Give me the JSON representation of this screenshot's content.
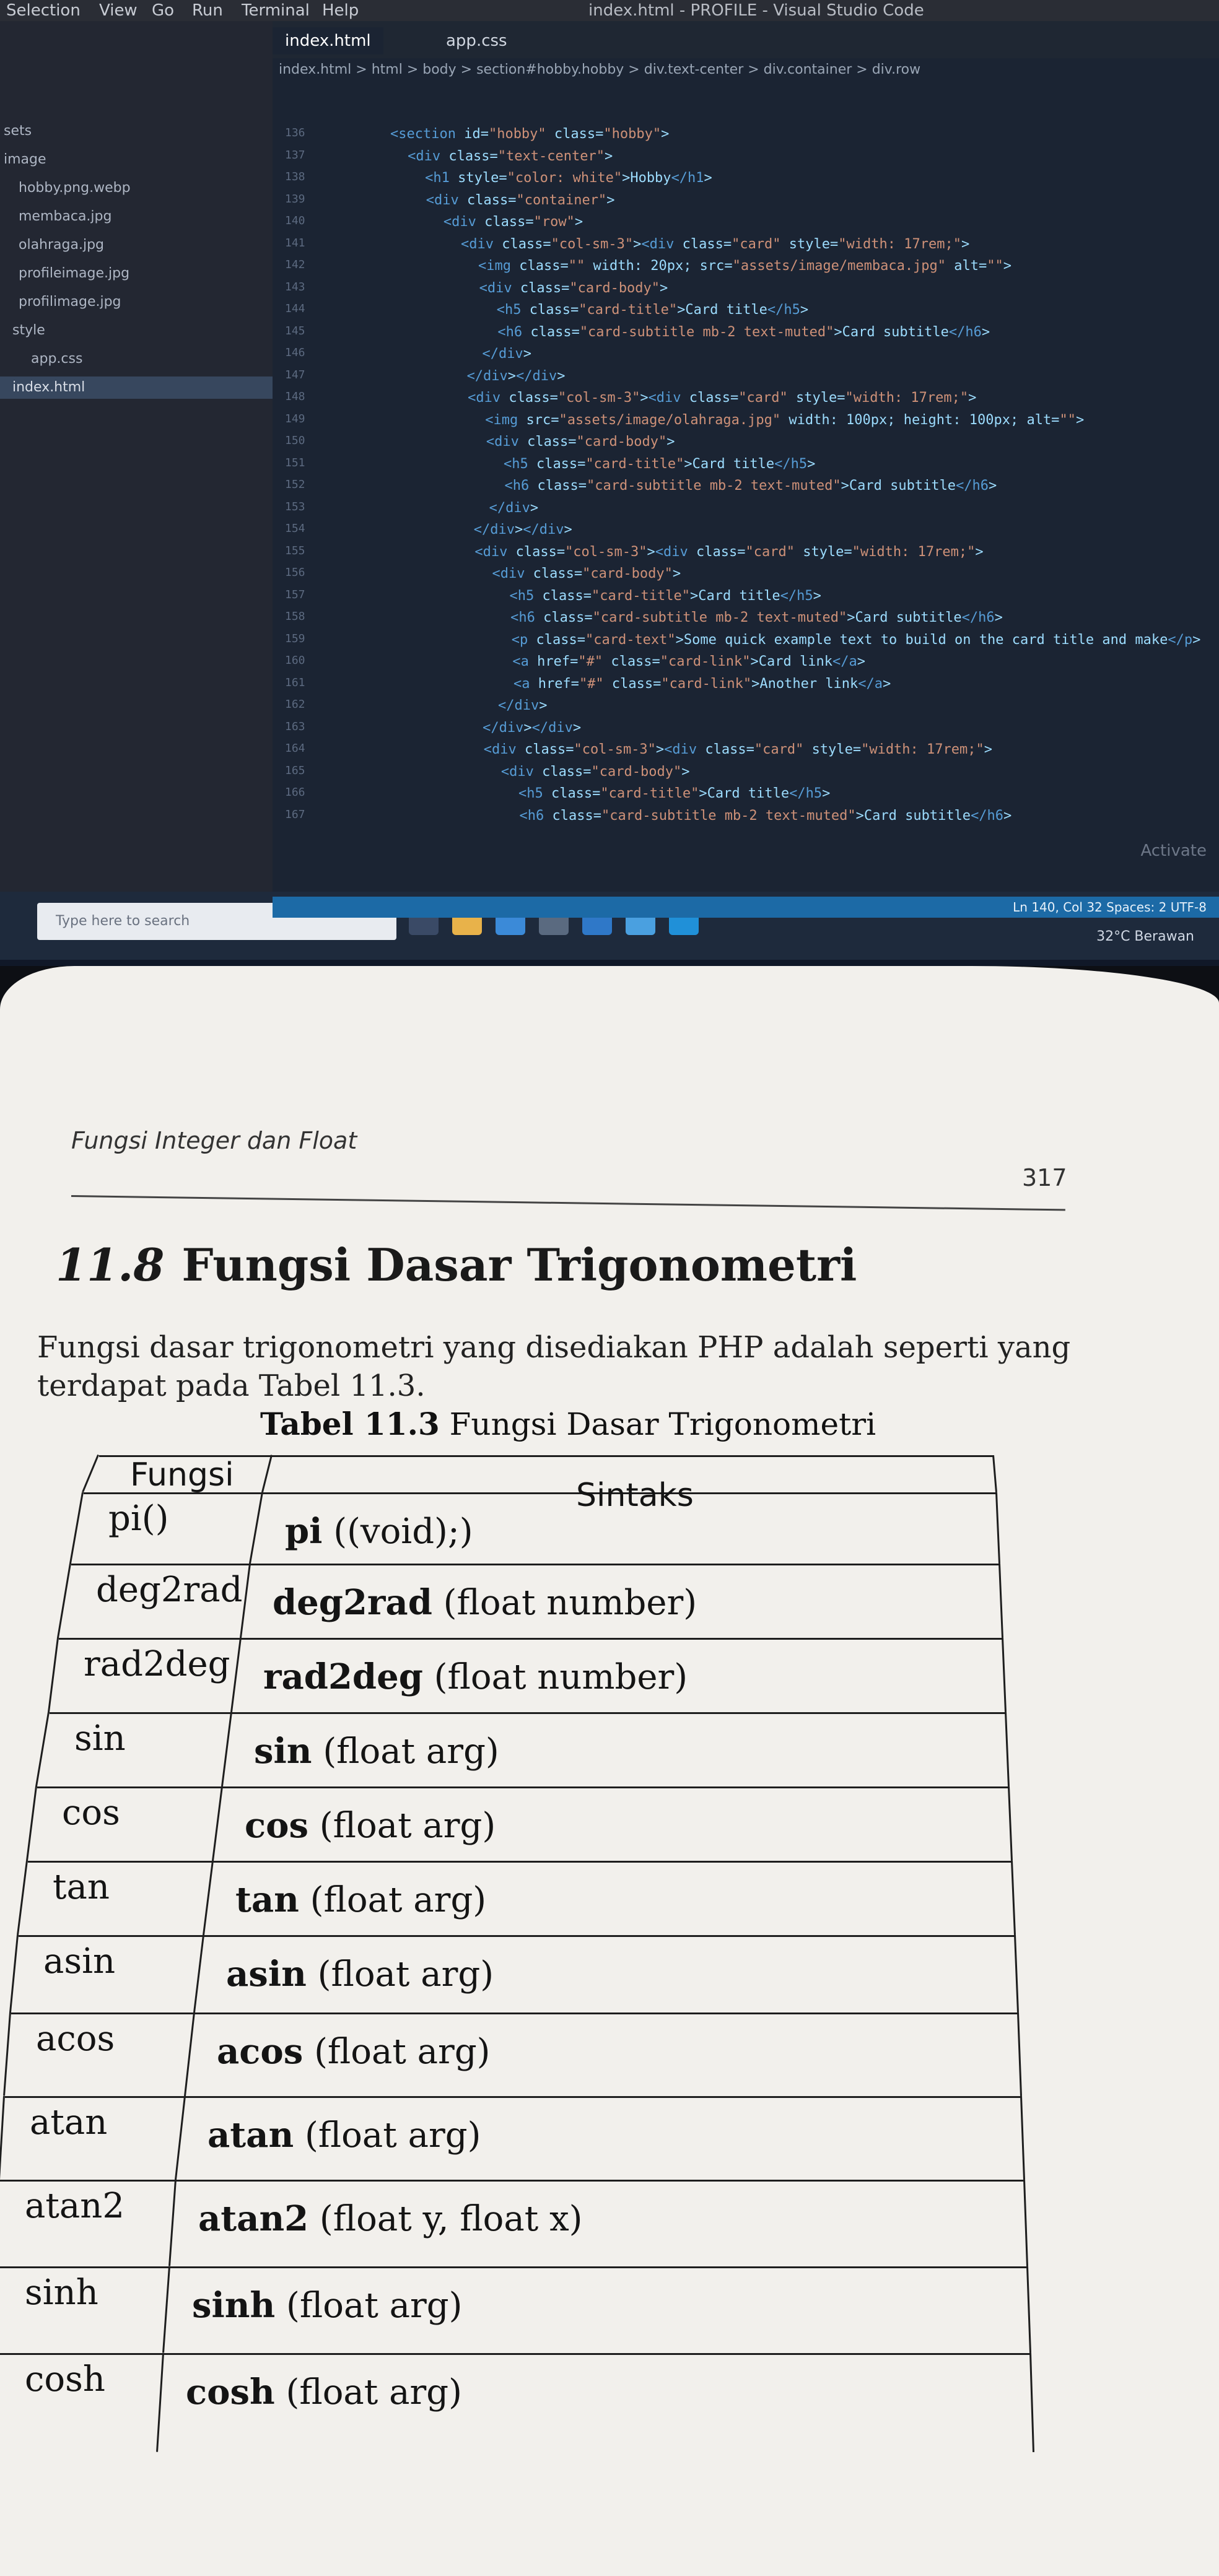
{
  "window": {
    "menu": [
      "Selection",
      "View",
      "Go",
      "Run",
      "Terminal",
      "Help"
    ],
    "title": "index.html - PROFILE - Visual Studio Code"
  },
  "explorer": {
    "items": [
      "sets",
      "image",
      "hobby.png.webp",
      "membaca.jpg",
      "olahraga.jpg",
      "profileimage.jpg",
      "profilimage.jpg",
      "style",
      "app.css",
      "index.html"
    ]
  },
  "tabs": [
    "index.html",
    "app.css"
  ],
  "breadcrumb": "index.html > html > body > section#hobby.hobby > div.text-center > div.container > div.row",
  "code": {
    "line_numbers": [
      "136",
      "137",
      "138",
      "139",
      "140",
      "141",
      "142",
      "143",
      "144",
      "145",
      "146",
      "147",
      "148",
      "149",
      "150",
      "151",
      "152",
      "153",
      "154",
      "155",
      "156",
      "157",
      "158",
      "159",
      "160",
      "161",
      "162",
      "163",
      "164",
      "165",
      "166",
      "167"
    ],
    "lines": [
      "<section id=\"hobby\" class=\"hobby\">",
      "  <div class=\"text-center\">",
      "    <h1 style=\"color: white\">Hobby</h1>",
      "    <div class=\"container\">",
      "      <div class=\"row\">",
      "        <div class=\"col-sm-3\"><div class=\"card\" style=\"width: 17rem;\">",
      "          <img class=\"\" width: 20px; src=\"assets/image/membaca.jpg\" alt=\"\">",
      "          <div class=\"card-body\">",
      "            <h5 class=\"card-title\">Card title</h5>",
      "            <h6 class=\"card-subtitle mb-2 text-muted\">Card subtitle</h6>",
      "          </div>",
      "        </div></div>",
      "        <div class=\"col-sm-3\"><div class=\"card\" style=\"width: 17rem;\">",
      "          <img src=\"assets/image/olahraga.jpg\" width: 100px; height: 100px; alt=\"\">",
      "          <div class=\"card-body\">",
      "            <h5 class=\"card-title\">Card title</h5>",
      "            <h6 class=\"card-subtitle mb-2 text-muted\">Card subtitle</h6>",
      "          </div>",
      "        </div></div>",
      "        <div class=\"col-sm-3\"><div class=\"card\" style=\"width: 17rem;\">",
      "          <div class=\"card-body\">",
      "            <h5 class=\"card-title\">Card title</h5>",
      "            <h6 class=\"card-subtitle mb-2 text-muted\">Card subtitle</h6>",
      "            <p class=\"card-text\">Some quick example text to build on the card title and make</p>",
      "            <a href=\"#\" class=\"card-link\">Card link</a>",
      "            <a href=\"#\" class=\"card-link\">Another link</a>",
      "          </div>",
      "        </div></div>",
      "        <div class=\"col-sm-3\"><div class=\"card\" style=\"width: 17rem;\">",
      "          <div class=\"card-body\">",
      "            <h5 class=\"card-title\">Card title</h5>",
      "            <h6 class=\"card-subtitle mb-2 text-muted\">Card subtitle</h6>"
    ]
  },
  "watermark": "Activate",
  "status": "Ln 140, Col 32   Spaces: 2   UTF-8",
  "taskbar": {
    "search_placeholder": "Type here to search",
    "weather": "32°C  Berawan"
  },
  "book": {
    "running_header": "Fungsi Integer dan Float",
    "page_number": "317",
    "section_number": "11.8",
    "section_title": "Fungsi Dasar Trigonometri",
    "intro_line1": "Fungsi dasar trigonometri yang disediakan PHP adalah seperti yang",
    "intro_line2": "terdapat pada Tabel 11.3.",
    "caption_label": "Tabel 11.3",
    "caption_text": " Fungsi Dasar Trigonometri",
    "table": {
      "headers": [
        "Fungsi",
        "Sintaks"
      ],
      "rows": [
        {
          "fungsi": "pi()",
          "fn": "pi",
          "args": " ((void);)"
        },
        {
          "fungsi": "deg2rad",
          "fn": "deg2rad",
          "args": " (float number)"
        },
        {
          "fungsi": "rad2deg",
          "fn": "rad2deg",
          "args": " (float number)"
        },
        {
          "fungsi": "sin",
          "fn": "sin",
          "args": " (float arg)"
        },
        {
          "fungsi": "cos",
          "fn": "cos",
          "args": " (float arg)"
        },
        {
          "fungsi": "tan",
          "fn": "tan",
          "args": " (float arg)"
        },
        {
          "fungsi": "asin",
          "fn": "asin",
          "args": " (float arg)"
        },
        {
          "fungsi": "acos",
          "fn": "acos",
          "args": " (float arg)"
        },
        {
          "fungsi": "atan",
          "fn": "atan",
          "args": " (float arg)"
        },
        {
          "fungsi": "atan2",
          "fn": "atan2",
          "args": " (float y, float x)"
        },
        {
          "fungsi": "sinh",
          "fn": "sinh",
          "args": " (float arg)"
        },
        {
          "fungsi": "cosh",
          "fn": "cosh",
          "args": " (float arg)"
        }
      ]
    }
  }
}
